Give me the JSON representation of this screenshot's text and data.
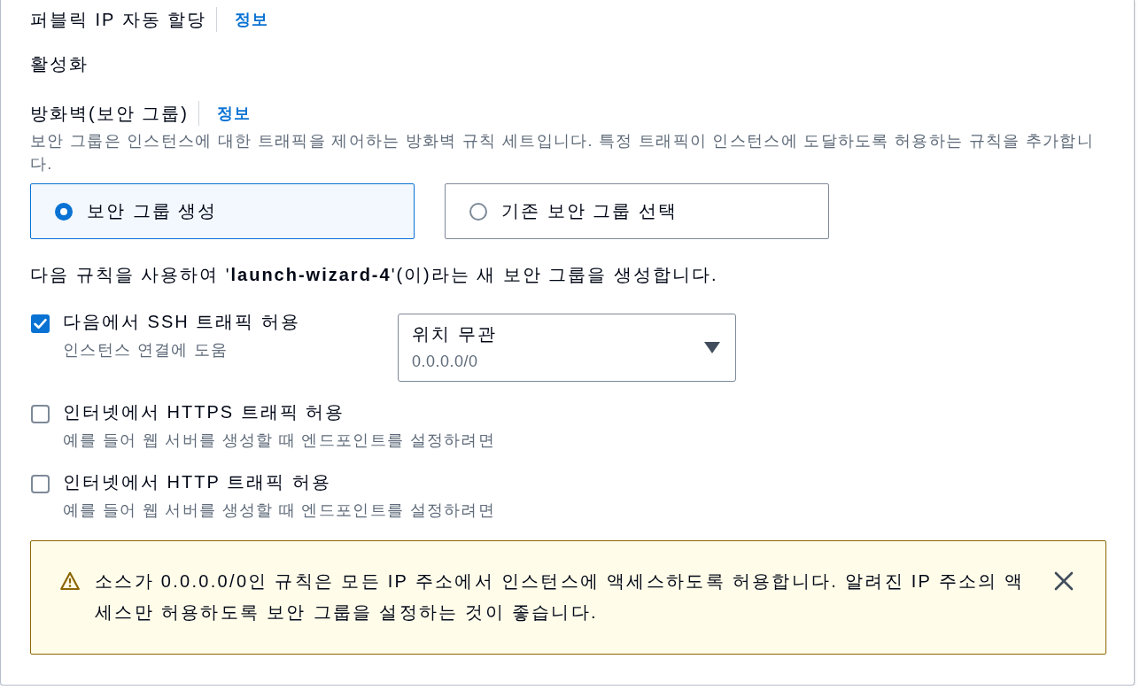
{
  "public_ip": {
    "label": "퍼블릭 IP 자동 할당",
    "info_link": "정보",
    "value": "활성화"
  },
  "firewall": {
    "label": "방화벽(보안 그룹)",
    "info_link": "정보",
    "description": "보안 그룹은 인스턴스에 대한 트래픽을 제어하는 방화벽 규칙 세트입니다. 특정 트래픽이 인스턴스에 도달하도록 허용하는 규칙을 추가합니다.",
    "options": [
      {
        "label": "보안 그룹 생성",
        "selected": true
      },
      {
        "label": "기존 보안 그룹 선택",
        "selected": false
      }
    ],
    "summary": "다음 규칙을 사용하여 '**launch-wizard-4**'(이)라는 새 보안 그룹을 생성합니다.",
    "rules": [
      {
        "label": "다음에서 SSH 트래픽 허용",
        "description": "인스턴스 연결에 도움",
        "checked": true,
        "source": {
          "value": "위치 무관",
          "detail": "0.0.0.0/0"
        }
      },
      {
        "label": "인터넷에서 HTTPS 트래픽 허용",
        "description": "예를 들어 웹 서버를 생성할 때 엔드포인트를 설정하려면",
        "checked": false
      },
      {
        "label": "인터넷에서 HTTP 트래픽 허용",
        "description": "예를 들어 웹 서버를 생성할 때 엔드포인트를 설정하려면",
        "checked": false
      }
    ],
    "alert": {
      "kind": "warning",
      "text": "소스가 0.0.0.0/0인 규칙은 모든 IP 주소에서 인스턴스에 액세스하도록 허용합니다. 알려진 IP 주소의 액세스만 허용하도록 보안 그룹을 설정하는 것이 좋습니다.",
      "dismissible": true
    }
  }
}
